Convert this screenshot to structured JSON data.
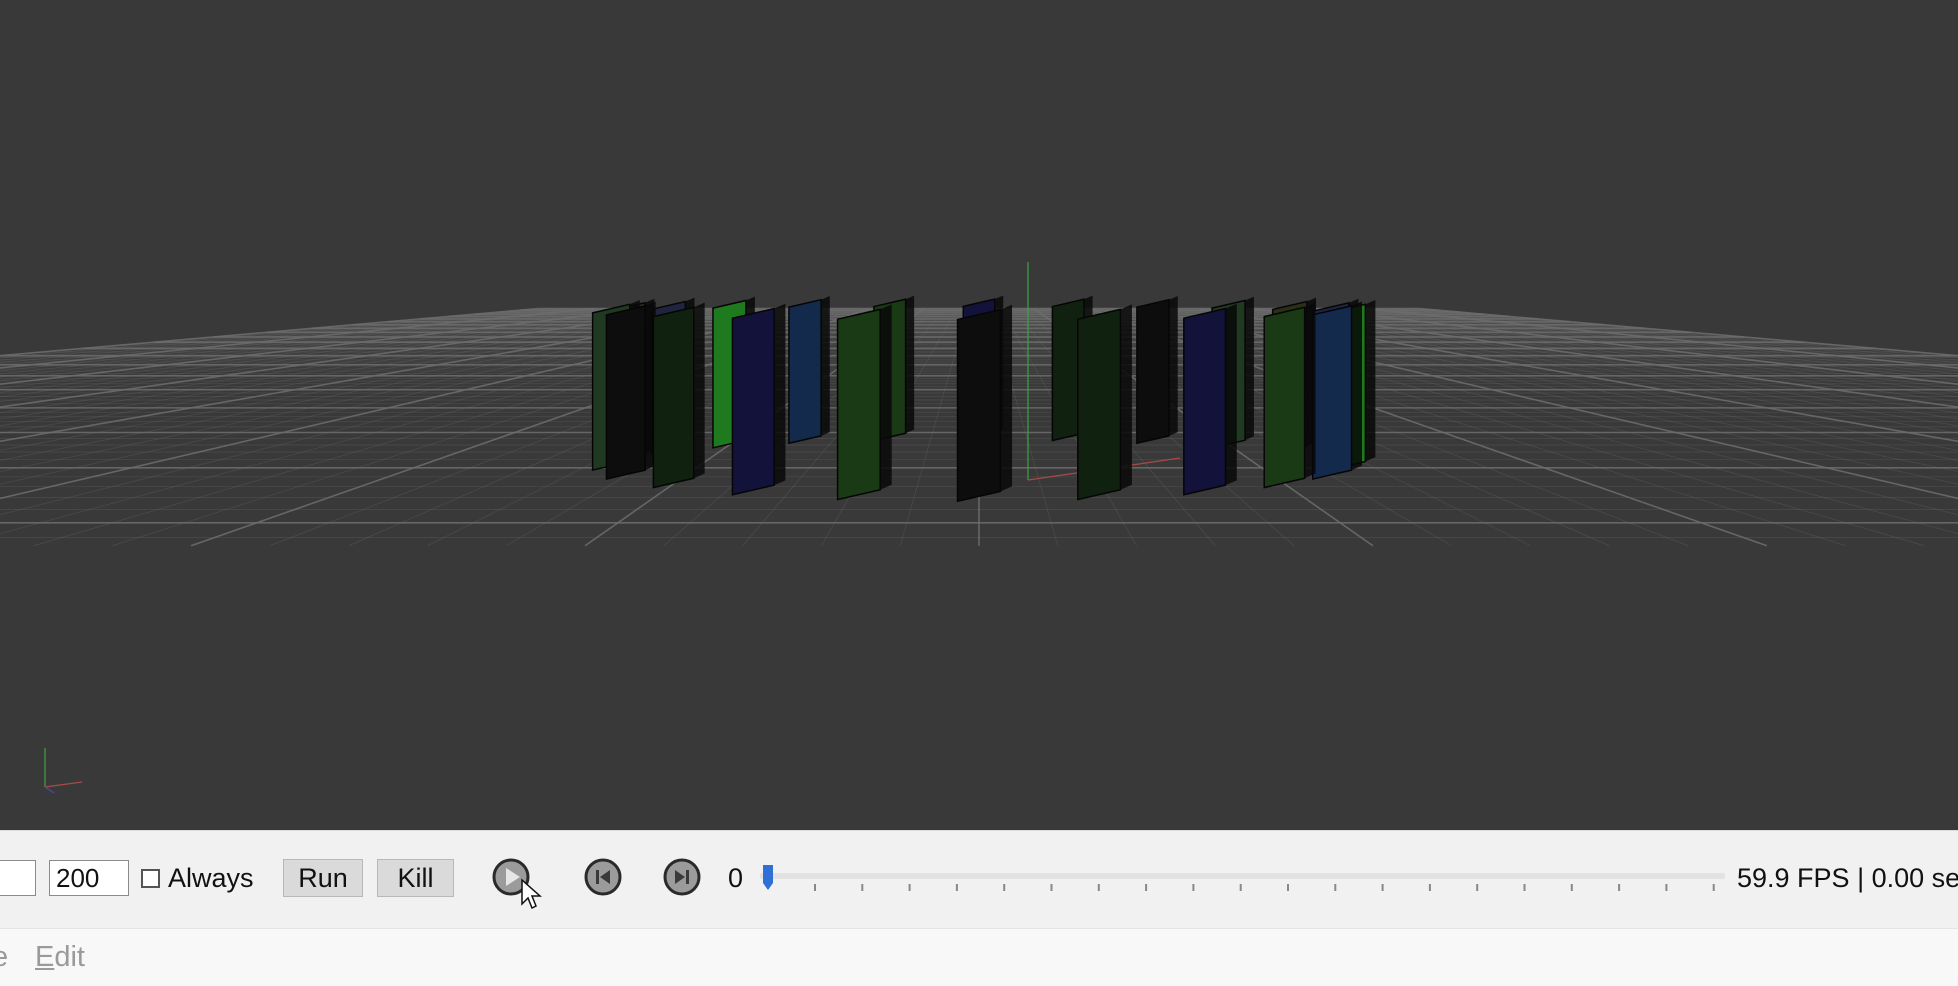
{
  "viewport": {
    "background": "#393939",
    "grid_color": "#6e6e6e",
    "domino_colors": [
      "#0d0d0d",
      "#10210f",
      "#12123a",
      "#1a3a15",
      "#132a4d",
      "#1f7a1f",
      "#20243f",
      "#2a3015",
      "#203a22"
    ]
  },
  "toolbar": {
    "left_field_value": "",
    "steps_value": "200",
    "always_label": "Always",
    "always_checked": false,
    "run_label": "Run",
    "kill_label": "Kill",
    "play_icon": "play-icon",
    "step_back_icon": "step-back-icon",
    "step_forward_icon": "step-forward-icon",
    "frame": "0",
    "timeline_progress": 0,
    "fps": "59.9 FPS | 0.00 se"
  },
  "menubar": {
    "file_visible_fragment": "e",
    "edit_label_first": "E",
    "edit_label_rest": "dit"
  },
  "colors": {
    "accent": "#2f6fd6",
    "toolbar_bg": "#f1f1f1"
  }
}
